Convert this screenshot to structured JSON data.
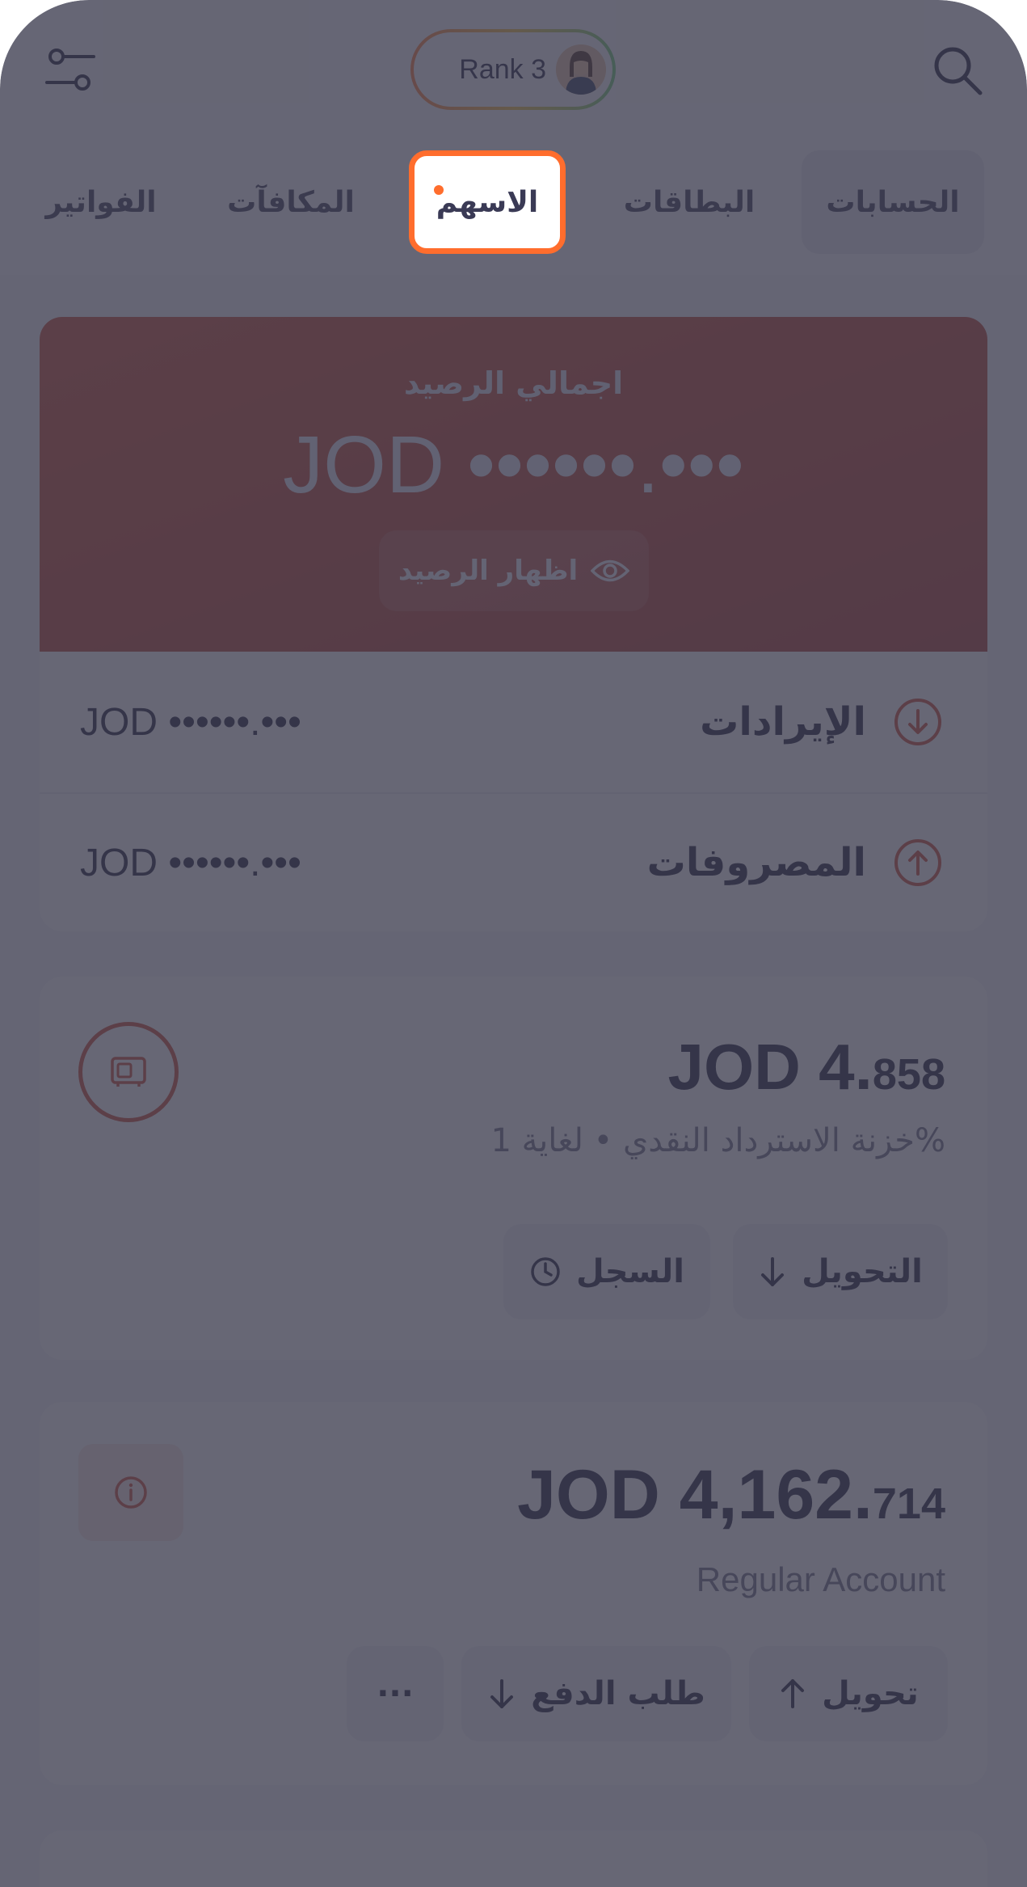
{
  "header": {
    "rank_label": "Rank 3",
    "filter_icon": "sliders-icon",
    "search_icon": "search-icon",
    "avatar_icon": "user-avatar"
  },
  "tabs": [
    {
      "label": "الحسابات"
    },
    {
      "label": "البطاقات"
    },
    {
      "label": "الاسهم"
    },
    {
      "label": "المكافآت"
    },
    {
      "label": "الفواتير"
    }
  ],
  "balance": {
    "title": "اجمالي الرصيد",
    "amount": "JOD ••••••.•••",
    "show_label": "اظهار الرصيد",
    "income_label": "الإيرادات",
    "income_value": "JOD ••••••.•••",
    "expenses_label": "المصروفات",
    "expenses_value": "JOD ••••••.•••"
  },
  "vault": {
    "amount_main": "JOD 4.",
    "amount_frac": "858",
    "subtitle": "خزنة الاسترداد النقدي • لغاية 1%",
    "transfer_label": "التحويل",
    "history_label": "السجل"
  },
  "regular": {
    "amount_main": "JOD 4,162.",
    "amount_frac": "714",
    "subtitle": "Regular Account",
    "transfer_label": "تحويل",
    "request_label": "طلب الدفع",
    "more_label": "···"
  },
  "colors": {
    "accent": "#ff6d2d",
    "hero": "#c94a32",
    "overlay": "rgba(60,60,78,0.78)"
  }
}
